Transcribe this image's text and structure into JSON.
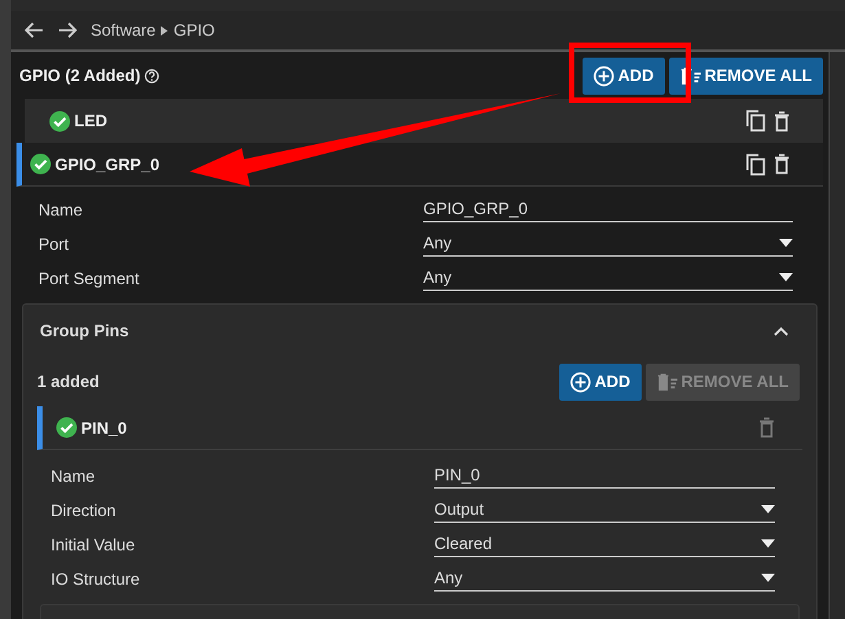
{
  "breadcrumb": [
    "Software",
    "GPIO"
  ],
  "module": {
    "title": "GPIO (2 Added)",
    "add_label": "ADD",
    "remove_all_label": "REMOVE ALL",
    "remove_all_disabled": false
  },
  "instances": [
    {
      "name": "LED",
      "selected": false
    },
    {
      "name": "GPIO_GRP_0",
      "selected": true
    }
  ],
  "fields": [
    {
      "kind": "text",
      "label": "Name",
      "value": "GPIO_GRP_0"
    },
    {
      "kind": "select",
      "label": "Port",
      "value": "Any"
    },
    {
      "kind": "select",
      "label": "Port Segment",
      "value": "Any"
    }
  ],
  "group": {
    "title": "Group Pins",
    "expanded": true,
    "count": "1 added",
    "add_label": "ADD",
    "remove_all_label": "REMOVE ALL",
    "remove_all_disabled": true,
    "pins": [
      {
        "name": "PIN_0",
        "selected": true
      }
    ],
    "fields": [
      {
        "kind": "text",
        "label": "Name",
        "value": "PIN_0"
      },
      {
        "kind": "select",
        "label": "Direction",
        "value": "Output"
      },
      {
        "kind": "select",
        "label": "Initial Value",
        "value": "Cleared"
      },
      {
        "kind": "select",
        "label": "IO Structure",
        "value": "Any"
      }
    ]
  }
}
